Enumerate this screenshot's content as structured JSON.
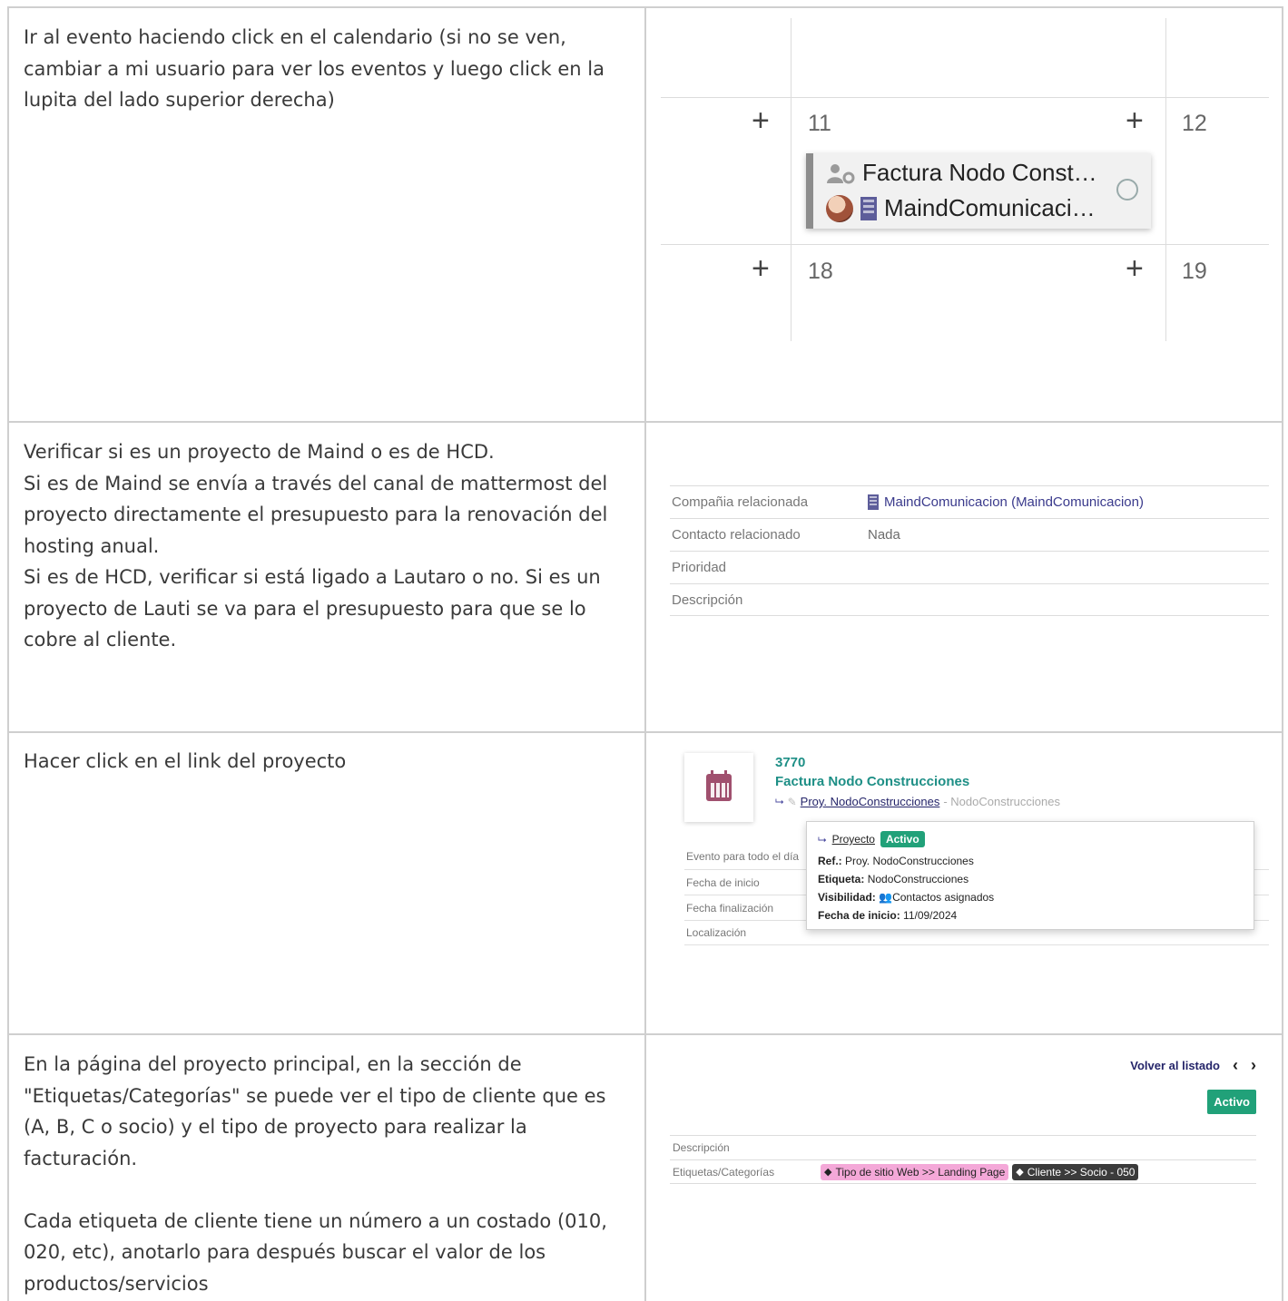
{
  "rows": [
    {
      "instruction": "Ir al evento haciendo click en el calendario (si no se ven, cambiar a mi usuario para ver los eventos y luego click en la lupita del lado superior derecha)"
    },
    {
      "instruction_lines": [
        "Verificar si es un proyecto de Maind o es de HCD.",
        "Si es de Maind se envía a través del canal de mattermost del proyecto directamente el presupuesto para la renovación del hosting anual.",
        "Si es de HCD, verificar si está ligado a Lautaro o no. Si es un proyecto de Lauti se va para el presupuesto para que se lo cobre al cliente."
      ]
    },
    {
      "instruction": "Hacer click en el link del proyecto"
    },
    {
      "instruction_p1": "En la página del proyecto principal, en la sección de \"Etiquetas/Categorías\" se puede ver el tipo de cliente que es (A, B, C o socio) y el tipo de proyecto para realizar la facturación.",
      "instruction_p2": "Cada etiqueta de cliente tiene un número a un costado (010, 020, etc), anotarlo para después buscar el valor de los productos/servicios"
    }
  ],
  "calendar": {
    "plus": "+",
    "days": [
      "11",
      "12",
      "18",
      "19"
    ],
    "event": {
      "title": "Factura Nodo Const…",
      "company": "MaindComunicaci…",
      "icons": [
        "user-gear-icon",
        "avatar",
        "building-icon"
      ]
    }
  },
  "company_fields": [
    {
      "label": "Compañia relacionada",
      "value": "MaindComunicacion (MaindComunicacion)",
      "icon": "building-icon"
    },
    {
      "label": "Contacto relacionado",
      "value": "Nada"
    },
    {
      "label": "Prioridad",
      "value": ""
    },
    {
      "label": "Descripción",
      "value": ""
    }
  ],
  "event_record": {
    "number": "3770",
    "title": "Factura Nodo Construcciones",
    "project_link": "Proy. NodoConstrucciones",
    "project_suffix": "- NodoConstrucciones",
    "fields": [
      "Evento para todo el día",
      "Fecha de inicio",
      "Fecha finalización",
      "Localización"
    ],
    "popover": {
      "link": "Proyecto",
      "badge": "Activo",
      "ref_label": "Ref.:",
      "ref_value": "Proy. NodoConstrucciones",
      "tag_label": "Etiqueta:",
      "tag_value": "NodoConstrucciones",
      "vis_label": "Visibilidad:",
      "vis_value": "Contactos asignados",
      "start_label": "Fecha de inicio:",
      "start_value": "11/09/2024"
    }
  },
  "project_page": {
    "back_label": "Volver al listado",
    "prev": "‹",
    "next": "›",
    "status": "Activo",
    "fields": [
      {
        "label": "Descripción"
      },
      {
        "label": "Etiquetas/Categorías"
      }
    ],
    "tags": [
      {
        "text": "Tipo de sitio Web >> Landing Page",
        "color": "#f4a8d8"
      },
      {
        "text": "Cliente >> Socio - 050",
        "color": "#3b3b3b"
      }
    ]
  },
  "colors": {
    "teal": "#1e8f86",
    "green_badge": "#21a179",
    "link_navy": "#25256a",
    "border": "#cfcfcf"
  }
}
